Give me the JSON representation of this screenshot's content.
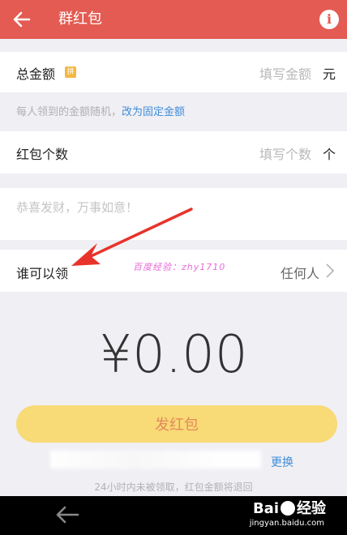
{
  "header": {
    "title": "群红包",
    "info_label": "i"
  },
  "total": {
    "label": "总金额",
    "badge": "拼",
    "placeholder": "填写金额",
    "unit": "元"
  },
  "hint": {
    "prefix": "每人领到的金额随机，",
    "link": "改为固定金额"
  },
  "count": {
    "label": "红包个数",
    "placeholder": "填写个数",
    "unit": "个"
  },
  "greeting": {
    "placeholder": "恭喜发财，万事如意！"
  },
  "recipient": {
    "label": "谁可以领",
    "value": "任何人"
  },
  "watermark": "百度经验：zhy1710",
  "amount": "¥0.00",
  "send_button": "发红包",
  "change_link": "更换",
  "footer_note": "24小时内未被领取，红包金额将退回",
  "nav": {
    "logo_left": "Bai",
    "logo_right": "经验",
    "url": "jingyan.baidu.com"
  },
  "colors": {
    "header": "#e35b52",
    "button": "#f8da76",
    "link": "#3f8ed8"
  }
}
